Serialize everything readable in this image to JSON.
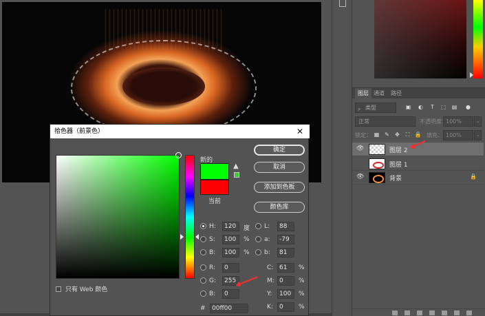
{
  "dialog": {
    "title": "拾色器（前景色）",
    "close_glyph": "✕",
    "label_new": "新的",
    "label_current": "当前",
    "new_color": "#00ff00",
    "current_color": "#ff0000",
    "warn_glyph": "▲",
    "buttons": {
      "ok": "确定",
      "cancel": "取消",
      "add_swatch": "添加到色板",
      "color_library": "颜色库"
    },
    "web_only": "只有 Web 颜色",
    "fields": {
      "H": {
        "label": "H:",
        "value": "120",
        "unit": "度"
      },
      "S": {
        "label": "S:",
        "value": "100",
        "unit": "%"
      },
      "Bv": {
        "label": "B:",
        "value": "100",
        "unit": "%"
      },
      "R": {
        "label": "R:",
        "value": "0"
      },
      "G": {
        "label": "G:",
        "value": "255"
      },
      "B": {
        "label": "B:",
        "value": "0"
      },
      "L": {
        "label": "L:",
        "value": "88"
      },
      "a": {
        "label": "a:",
        "value": "-79"
      },
      "b": {
        "label": "b:",
        "value": "81"
      },
      "C": {
        "label": "C:",
        "value": "61",
        "unit": "%"
      },
      "M": {
        "label": "M:",
        "value": "0",
        "unit": "%"
      },
      "Y": {
        "label": "Y:",
        "value": "100",
        "unit": "%"
      },
      "K": {
        "label": "K:",
        "value": "0",
        "unit": "%"
      }
    },
    "hex": {
      "label": "#",
      "value": "00ff00"
    }
  },
  "layers_panel": {
    "tabs": [
      "图层",
      "通道",
      "路径"
    ],
    "filter_placeholder": "类型",
    "blend_mode": "正常",
    "opacity_label": "不透明度：",
    "opacity_value": "100%",
    "lock_label": "锁定：",
    "fill_label": "填充：",
    "fill_value": "100%",
    "layers": [
      {
        "name": "图层 2",
        "visible": true,
        "selected": true
      },
      {
        "name": "图层 1",
        "visible": false,
        "selected": false
      },
      {
        "name": "背景",
        "visible": true,
        "selected": false,
        "locked": true
      }
    ]
  },
  "icons": {
    "eye": "eye-icon",
    "lock": "lock-icon",
    "search": "search-icon"
  }
}
